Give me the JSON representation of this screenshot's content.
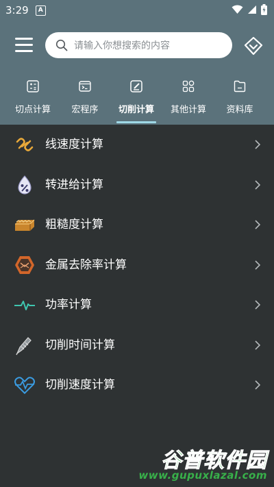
{
  "status_bar": {
    "time": "3:29",
    "notification_letter": "A"
  },
  "search": {
    "placeholder": "请输入你想搜索的内容"
  },
  "tabs": [
    {
      "label": "切点计算",
      "icon": "calculator-icon"
    },
    {
      "label": "宏程序",
      "icon": "terminal-icon"
    },
    {
      "label": "切削计算",
      "icon": "edit-icon",
      "active": true
    },
    {
      "label": "其他计算",
      "icon": "grid-icon"
    },
    {
      "label": "资料库",
      "icon": "folder-icon"
    }
  ],
  "list": [
    {
      "label": "线速度计算",
      "icon": "chain-link-icon",
      "color": "#e8a93a"
    },
    {
      "label": "转进给计算",
      "icon": "percent-drop-icon",
      "color": "#d6d6f0"
    },
    {
      "label": "粗糙度计算",
      "icon": "surface-block-icon",
      "color": "#e0a040"
    },
    {
      "label": "金属去除率计算",
      "icon": "hexagon-metal-icon",
      "color": "#e06a30"
    },
    {
      "label": "功率计算",
      "icon": "pulse-icon",
      "color": "#3fc6b0"
    },
    {
      "label": "切削时间计算",
      "icon": "cutter-tool-icon",
      "color": "#c9c9c9"
    },
    {
      "label": "切削速度计算",
      "icon": "heart-rate-icon",
      "color": "#3a9be0"
    }
  ],
  "watermark": {
    "title": "谷普软件园",
    "url": "www.gupuxlazal.com"
  }
}
